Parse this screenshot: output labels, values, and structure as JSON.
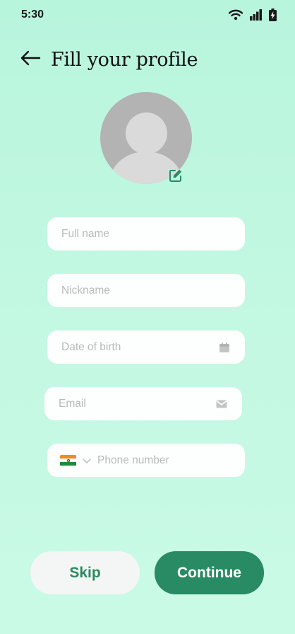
{
  "status_bar": {
    "time": "5:30"
  },
  "header": {
    "title": "Fill your profile"
  },
  "form": {
    "full_name_placeholder": "Full name",
    "nickname_placeholder": "Nickname",
    "dob_placeholder": "Date of birth",
    "email_placeholder": "Email",
    "phone_placeholder": "Phone number",
    "country": "India"
  },
  "actions": {
    "skip_label": "Skip",
    "continue_label": "Continue"
  },
  "colors": {
    "accent": "#298b63",
    "background": "#c3f8e2",
    "field_bg": "#fdfefe",
    "placeholder": "#b9b9b9"
  },
  "icons": {
    "back": "arrow-left-icon",
    "edit": "edit-square-icon",
    "calendar": "calendar-icon",
    "email": "mail-icon",
    "dropdown": "chevron-down-icon"
  }
}
